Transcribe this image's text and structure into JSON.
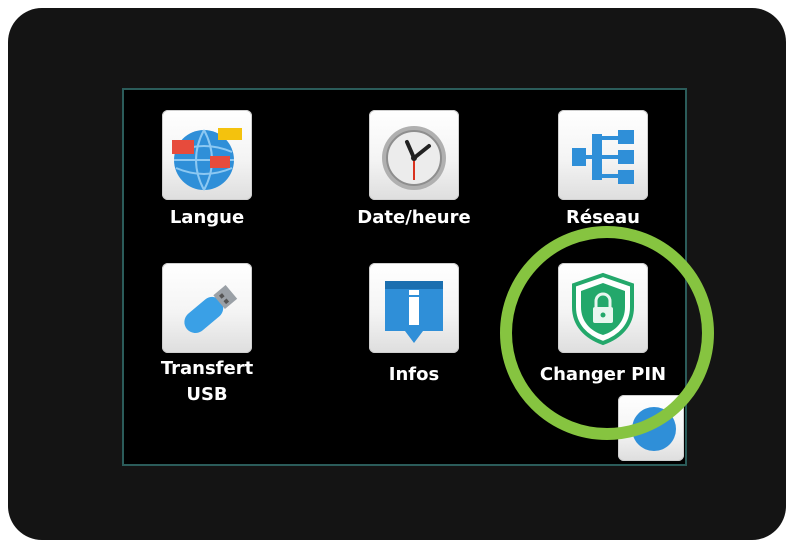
{
  "settings_menu": {
    "items": [
      {
        "label": "Langue",
        "icon": "globe-flags-icon"
      },
      {
        "label": "Date/heure",
        "icon": "clock-icon"
      },
      {
        "label": "Réseau",
        "icon": "network-tree-icon"
      },
      {
        "label": "Transfert USB",
        "label_line1": "Transfert",
        "label_line2": "USB",
        "icon": "usb-stick-icon"
      },
      {
        "label": "Infos",
        "icon": "info-icon"
      },
      {
        "label": "Changer PIN",
        "icon": "shield-lock-icon"
      }
    ],
    "partial_item": {
      "icon": "blue-circle-icon"
    }
  },
  "colors": {
    "highlight": "#86c440",
    "screen_border": "#2b5c5a",
    "icon_blue": "#2f8fd8",
    "shield_green": "#23a86b"
  }
}
